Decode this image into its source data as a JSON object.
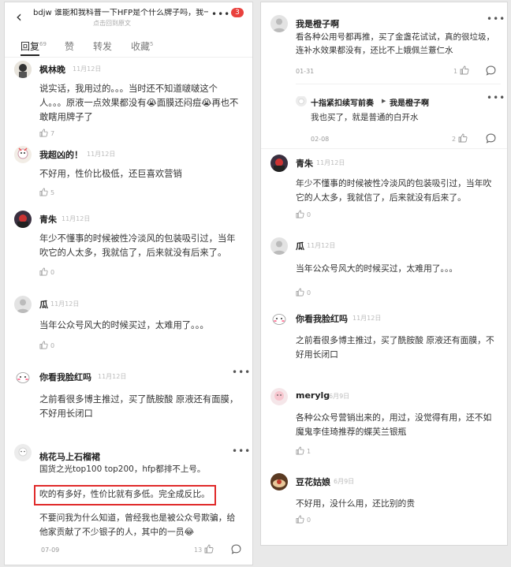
{
  "left": {
    "header": {
      "title": "bdjw 谁能和我科普一下HFP是个什么牌子吗，我一度...",
      "subtitle": "点击回到原文",
      "badge": "3",
      "more": "•••"
    },
    "tabs": [
      {
        "label": "回复",
        "count": "69"
      },
      {
        "label": "赞",
        "count": ""
      },
      {
        "label": "转发",
        "count": ""
      },
      {
        "label": "收藏",
        "count": "5"
      }
    ],
    "comments": [
      {
        "user": "枫林晚",
        "date": "11月12日",
        "text": "说实话，我用过的。。。当时还不知道啵啵这个人。。。原液一点效果都没有😭面膜还闷痘😭再也不敢瞎用牌子了",
        "likes": "7"
      },
      {
        "user": "我超凶的！",
        "date": "11月12日",
        "text": "不好用，性价比极低，还巨喜欢营销",
        "likes": "5"
      },
      {
        "user": "青朱",
        "date": "11月12日",
        "text": "年少不懂事的时候被性冷淡风的包装吸引过，当年吹它的人太多，我就信了，后来就没有后来了。",
        "likes": "0"
      },
      {
        "user": "瓜",
        "date": "11月12日",
        "text": "当年公众号风大的时候买过，太难用了。。。",
        "likes": "0"
      },
      {
        "user": "你看我脸红吗",
        "date": "11月12日",
        "text": "之前看很多博主推过，买了酰胺酸 原液还有面膜，不好用长闭口",
        "likes": "0"
      },
      {
        "user": "桃花马上石榴裙",
        "line1": "国货之光top100 top200，hfp都排不上号。",
        "highlight": "吹的有多好，性价比就有多低。完全成反比。",
        "line3": "不要问我为什么知道，曾经我也是被公众号欺骗，给他家贡献了不少银子的人，其中的一员😂",
        "date": "07-09",
        "likes": "13"
      }
    ]
  },
  "right": {
    "comments": [
      {
        "user": "我是橙子啊",
        "text": "看各种公用号都再推，买了金盏花试试，真的很垃圾，连补水效果都没有，还比不上娥佩兰薏仁水",
        "date": "01-31",
        "likes": "1"
      },
      {
        "user": "十指紧扣续写前奏",
        "arrow": "▶",
        "reply_to": "我是橙子啊",
        "text": "我也买了，就是普通的白开水",
        "date": "02-08",
        "likes": "2"
      },
      {
        "user": "青朱",
        "date": "11月12日",
        "text": "年少不懂事的时候被性冷淡风的包装吸引过，当年吹它的人太多，我就信了，后来就没有后来了。",
        "likes": "0"
      },
      {
        "user": "瓜",
        "date": "11月12日",
        "text": "当年公众号风大的时候买过，太难用了。。。",
        "likes": "0"
      },
      {
        "user": "你看我脸红吗",
        "date": "11月12日",
        "text": "之前看很多博主推过，买了酰胺酸 原液还有面膜，不好用长闭口",
        "likes": "0"
      },
      {
        "user": "merylg",
        "date": "6月9日",
        "text": "各种公众号营销出来的，用过，没觉得有用，还不如魔鬼李佳琦推荐的蝶芙兰银瓶",
        "likes": "1"
      },
      {
        "user": "豆花姑娘",
        "date": "6月9日",
        "text": "不好用，没什么用，还比别的贵",
        "likes": "0"
      }
    ]
  },
  "colors": {
    "highlight_border": "#e02a2a",
    "badge": "#e9413d"
  },
  "icons": [
    "back-arrow-icon",
    "thumbs-up-icon",
    "comment-bubble-icon",
    "more-dots-icon"
  ]
}
